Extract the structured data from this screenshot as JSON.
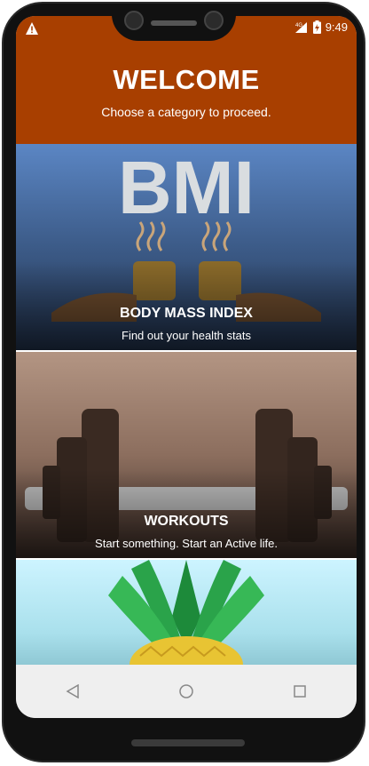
{
  "status_bar": {
    "warning_icon": "warning-icon",
    "network": "4G",
    "time": "9:49"
  },
  "header": {
    "title": "WELCOME",
    "subtitle": "Choose a category to proceed."
  },
  "categories": [
    {
      "title": "BODY MASS INDEX",
      "subtitle": "Find out your health stats",
      "image_text": "BMI",
      "icon": "bmi-image"
    },
    {
      "title": "WORKOUTS",
      "subtitle": "Start something. Start an Active life.",
      "icon": "dumbbell-image"
    },
    {
      "title": "",
      "subtitle": "",
      "icon": "pineapple-image"
    }
  ],
  "nav": {
    "back": "back-icon",
    "home": "home-icon",
    "recents": "recents-icon"
  },
  "colors": {
    "header": "#a83f00",
    "navbar": "#efefef"
  }
}
